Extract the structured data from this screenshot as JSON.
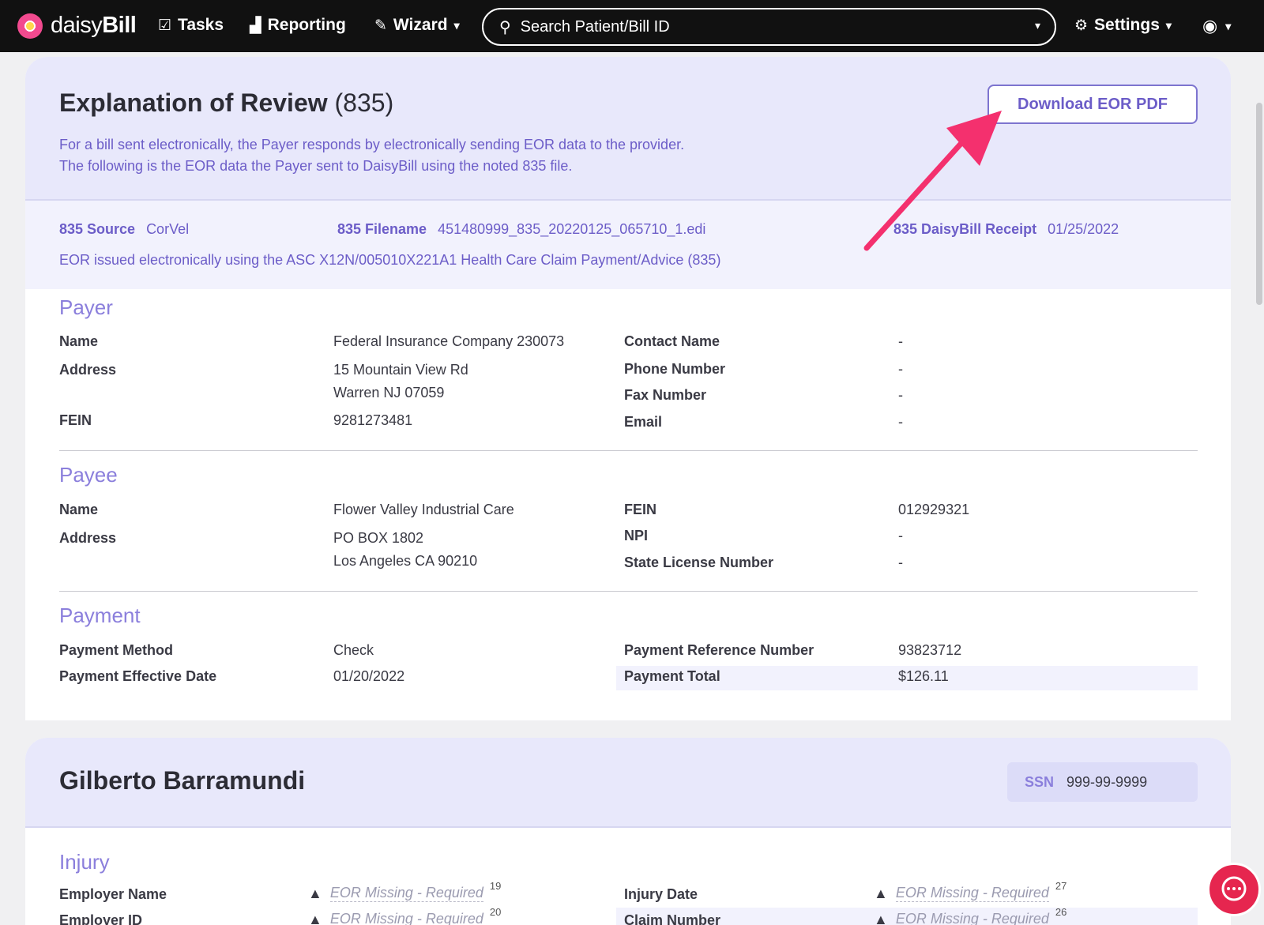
{
  "nav": {
    "brand_prefix": "daisy",
    "brand_suffix": "Bill",
    "tasks": "Tasks",
    "reporting": "Reporting",
    "wizard": "Wizard",
    "search_placeholder": "Search Patient/Bill ID",
    "settings": "Settings"
  },
  "eor": {
    "title": "Explanation of Review",
    "title_suffix": "(835)",
    "desc_line1": "For a bill sent electronically, the Payer responds by electronically sending EOR data to the provider.",
    "desc_line2": "The following is the EOR data the Payer sent to DaisyBill using the noted 835 file.",
    "download_button": "Download EOR PDF",
    "source_label": "835 Source",
    "source_value": "CorVel",
    "filename_label": "835 Filename",
    "filename_value": "451480999_835_20220125_065710_1.edi",
    "receipt_label": "835 DaisyBill Receipt",
    "receipt_value": "01/25/2022",
    "note": "EOR issued electronically using the ASC X12N/005010X221A1 Health Care Claim Payment/Advice (835)"
  },
  "payer": {
    "title": "Payer",
    "name_label": "Name",
    "name_value": "Federal Insurance Company 230073",
    "address_label": "Address",
    "address_line1": "15 Mountain View Rd",
    "address_line2": "Warren NJ 07059",
    "fein_label": "FEIN",
    "fein_value": "9281273481",
    "contact_label": "Contact Name",
    "contact_value": "-",
    "phone_label": "Phone Number",
    "phone_value": "-",
    "fax_label": "Fax Number",
    "fax_value": "-",
    "email_label": "Email",
    "email_value": "-"
  },
  "payee": {
    "title": "Payee",
    "name_label": "Name",
    "name_value": "Flower Valley Industrial Care",
    "address_label": "Address",
    "address_line1": "PO BOX 1802",
    "address_line2": "Los Angeles CA 90210",
    "fein_label": "FEIN",
    "fein_value": "012929321",
    "npi_label": "NPI",
    "npi_value": "-",
    "license_label": "State License Number",
    "license_value": "-"
  },
  "payment": {
    "title": "Payment",
    "method_label": "Payment Method",
    "method_value": "Check",
    "date_label": "Payment Effective Date",
    "date_value": "01/20/2022",
    "ref_label": "Payment Reference Number",
    "ref_value": "93823712",
    "total_label": "Payment Total",
    "total_value": "$126.11"
  },
  "patient": {
    "name": "Gilberto Barramundi",
    "ssn_label": "SSN",
    "ssn_value": "999-99-9999"
  },
  "injury": {
    "title": "Injury",
    "employer_name_label": "Employer Name",
    "employer_id_label": "Employer ID",
    "injury_date_label": "Injury Date",
    "claim_number_label": "Claim Number",
    "missing_text": "EOR Missing - Required",
    "employer_name_ref": "19",
    "employer_id_ref": "20",
    "injury_date_ref": "27",
    "claim_number_ref": "26"
  },
  "colors": {
    "accent": "#6c5dc8",
    "arrow": "#f4306e",
    "header_band": "#e8e8fb"
  }
}
